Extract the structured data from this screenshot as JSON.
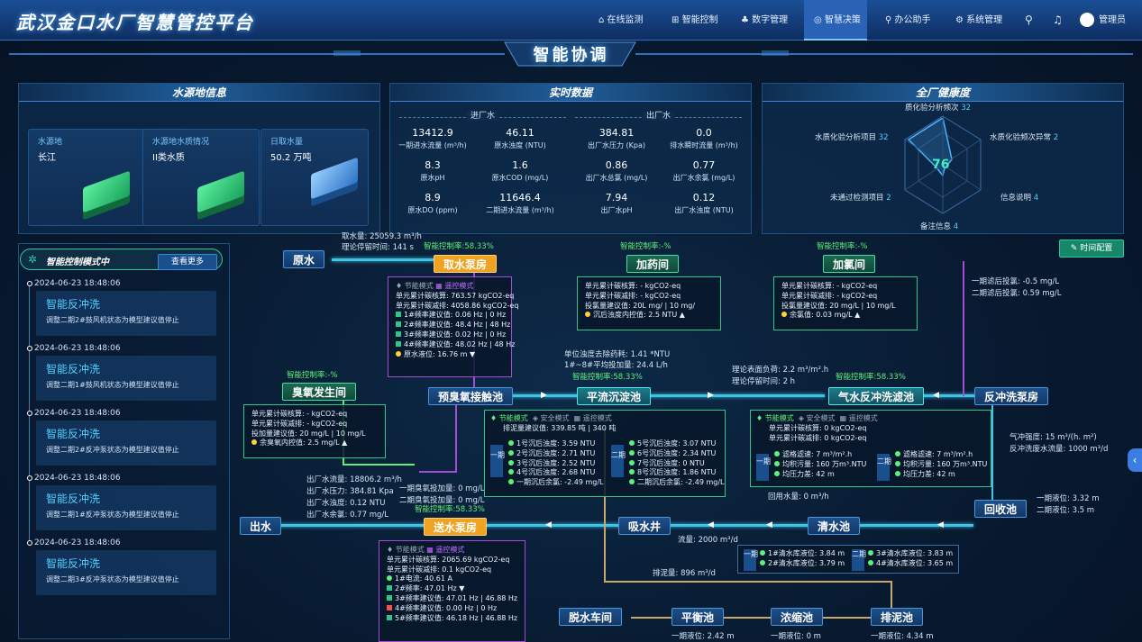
{
  "nav": {
    "brand": "武汉金口水厂智慧管控平台",
    "items": [
      {
        "icon": "⌂",
        "label": "在线监测"
      },
      {
        "icon": "⊞",
        "label": "智能控制"
      },
      {
        "icon": "♣",
        "label": "数字管理"
      },
      {
        "icon": "◎",
        "label": "智慧决策"
      },
      {
        "icon": "⚲",
        "label": "办公助手"
      },
      {
        "icon": "⚙",
        "label": "系统管理"
      }
    ],
    "user": "管理员"
  },
  "page_title": "智能协调",
  "source": {
    "title": "水源地信息",
    "cards": [
      {
        "label": "水源地",
        "value": "长江"
      },
      {
        "label": "水源地水质情况",
        "value": "II类水质"
      },
      {
        "label": "日取水量",
        "value": "50.2 万吨"
      }
    ]
  },
  "realtime": {
    "title": "实时数据",
    "in_title": "进厂水",
    "out_title": "出厂水",
    "cells": [
      {
        "v": "13412.9",
        "l": "一期进水流量 (m³/h)"
      },
      {
        "v": "46.11",
        "l": "原水浊度 (NTU)"
      },
      {
        "v": "384.81",
        "l": "出厂水压力 (Kpa)"
      },
      {
        "v": "0.0",
        "l": "排水瞬时流量 (m³/h)"
      },
      {
        "v": "8.3",
        "l": "原水pH"
      },
      {
        "v": "1.6",
        "l": "原水COD (mg/L)"
      },
      {
        "v": "0.86",
        "l": "出厂水总氯 (mg/L)"
      },
      {
        "v": "0.77",
        "l": "出厂水余氯 (mg/L)"
      },
      {
        "v": "8.9",
        "l": "原水DO (ppm)"
      },
      {
        "v": "11646.4",
        "l": "二期进水流量 (m³/h)"
      },
      {
        "v": "7.94",
        "l": "出厂水pH"
      },
      {
        "v": "0.12",
        "l": "出厂水浊度 (NTU)"
      }
    ]
  },
  "health": {
    "title": "全厂健康度",
    "score": "76",
    "axes": [
      {
        "label": "质化验分析频次",
        "value": "32"
      },
      {
        "label": "水质化验频次异常",
        "value": "2"
      },
      {
        "label": "信息说明",
        "value": "4"
      },
      {
        "label": "备注信息",
        "value": "4"
      },
      {
        "label": "未通过检测项目",
        "value": "2"
      },
      {
        "label": "水质化验分析项目",
        "value": "32"
      }
    ]
  },
  "sidebar": {
    "mode": "智能控制模式中",
    "more": "查看更多",
    "events": [
      {
        "time": "2024-06-23 18:48:06",
        "title": "智能反冲洗",
        "desc": "调整二期2#鼓风机状态为模型建议值停止"
      },
      {
        "time": "2024-06-23 18:48:06",
        "title": "智能反冲洗",
        "desc": "调整二期1#鼓风机状态为模型建议值停止"
      },
      {
        "time": "2024-06-23 18:48:06",
        "title": "智能反冲洗",
        "desc": "调整二期2#反冲泵状态为模型建议值停止"
      },
      {
        "time": "2024-06-23 18:48:06",
        "title": "智能反冲洗",
        "desc": "调整二期1#反冲泵状态为模型建议值停止"
      },
      {
        "time": "2024-06-23 18:48:06",
        "title": "智能反冲洗",
        "desc": "调整二期3#反冲泵状态为模型建议值停止"
      }
    ]
  },
  "timecfg": "时间配置",
  "nodes": {
    "raw": "原水",
    "intake": "取水泵房",
    "dosing": "加药间",
    "chlor": "加氯间",
    "ozone": "臭氧发生间",
    "preox": "预臭氧接触池",
    "sed": "平流沉淀池",
    "filter": "气水反冲洗滤池",
    "backpump": "反冲洗泵房",
    "recover": "回收池",
    "clear": "清水池",
    "suck": "吸水井",
    "send": "送水泵房",
    "out": "出水",
    "dewater": "脱水车间",
    "balance": "平衡池",
    "thicken": "浓缩池",
    "sludge": "排泥池"
  },
  "labels": {
    "intake_flow": "取水量: 25059.3 m³/h",
    "retention1": "理论停留时间: 141 s",
    "intake_rate": "智能控制率:58.33%",
    "dosing_rate": "智能控制率:-%",
    "chlor_rate": "智能控制率:-%",
    "ozone_rate": "智能控制率:-%",
    "sed_consume": "单位浊度去除药耗: 1.41 *NTU",
    "sed_avg": "1#~8#平均投加量: 24.4 L/h",
    "sed_rate": "智能控制率:58.33%",
    "surface_load": "理论表面负荷: 2.2 m³/m².h",
    "retention2": "理论停留时间: 2 h",
    "filter_rate": "智能控制率:58.33%",
    "post_chlor1": "一期滤后投氯: -0.5 mg/L",
    "post_chlor2": "二期滤后投氯: 0.59 mg/L",
    "air_intensity": "气冲强度: 15 m³/(h. m²)",
    "backwash_flow": "反冲洗废水流量: 1000 m³/d",
    "recycle": "回用水量: 0 m³/h",
    "level1": "一期液位: 3.32 m",
    "level2": "二期液位: 3.5 m",
    "out_flow": "出厂水流量: 18806.2 m³/h",
    "out_press": "出厂水压力: 384.81 Kpa",
    "out_turb": "出厂水浊度: 0.12 NTU",
    "out_cl": "出厂水余氯: 0.77 mg/L",
    "ozone1": "一期臭氧投加量: 0 mg/L",
    "ozone2": "二期臭氧投加量: 0 mg/L",
    "send_rate": "智能控制率:58.33%",
    "flow2000": "流量: 2000 m³/d",
    "sludge_flow": "排泥量: 896 m³/d",
    "lv_dewater": "一期液位: 2.42 m",
    "lv_thicken": "一期液位: 0 m",
    "lv_sludge": "一期液位: 4.34 m"
  },
  "intake_box": {
    "mode1": "节能模式",
    "mode2": "遥控模式",
    "lines": [
      "单元累计碳核算: 763.57 kgCO2-eq",
      "单元累计碳减排: 4058.86 kgCO2-eq",
      "1#频率建议值: 0.06 Hz | 0 Hz",
      "2#频率建议值: 48.4 Hz | 48 Hz",
      "3#频率建议值: 0.02 Hz | 0 Hz",
      "4#频率建议值: 48.02 Hz | 48 Hz",
      "原水液位: 16.76 m ▼"
    ]
  },
  "dosing_box": {
    "lines": [
      "单元累计碳核算: - kgCO2-eq",
      "单元累计碳减排: - kgCO2-eq",
      "投氯量建议值: 20L mg/ | 10 mg/",
      "沉后浊度内控值: 2.5 NTU ▲"
    ]
  },
  "chlor_box": {
    "lines": [
      "单元累计碳核算: - kgCO2-eq",
      "单元累计碳减排: - kgCO2-eq",
      "投氯量建议值: 20 mg/L | 10 mg/L",
      "余氯值: 0.03 mg/L ▲"
    ]
  },
  "ozone_box": {
    "lines": [
      "单元累计碳核算: - kgCO2-eq",
      "单元累计碳减排: - kgCO2-eq",
      "投加量建议值: 20 mg/L | 10 mg/L",
      "余臭氧内控值: 2.5 mg/L ▲"
    ]
  },
  "sed_box": {
    "m1": "节能模式",
    "m2": "安全模式",
    "m3": "遥控模式",
    "head": "排泥量建议值: 339.85 吨 | 340 吨",
    "p1": "一期",
    "p2": "二期",
    "left": [
      "1号沉后浊度: 3.59 NTU",
      "2号沉后浊度: 2.71 NTU",
      "3号沉后浊度: 2.52 NTU",
      "4号沉后浊度: 2.68 NTU",
      "一期沉后余氯: -2.49 mg/L"
    ],
    "right": [
      "5号沉后浊度: 3.07 NTU",
      "6号沉后浊度: 2.34 NTU",
      "7号沉后浊度: 0 NTU",
      "8号沉后浊度: 1.86 NTU",
      "二期沉后余氯: -2.49 mg/L"
    ]
  },
  "filter_box": {
    "m1": "节能模式",
    "m2": "安全模式",
    "m3": "遥控模式",
    "l1": "单元累计碳核算: 0 kgCO2-eq",
    "l2": "单元累计碳减排: 0 kgCO2-eq",
    "p1": "一期",
    "p2": "二期",
    "left": [
      "滤格滤速: 7 m³/m².h",
      "均积污量: 160 万m³.NTU",
      "均压力差: 42 m"
    ],
    "right": [
      "滤格滤速: 7 m³/m².h",
      "均积污量: 160 万m³.NTU",
      "均压力差: 42 m"
    ]
  },
  "clear_box": {
    "p1": "一期",
    "p2": "二期",
    "l": [
      "1#清水库液位: 3.84 m",
      "2#清水库液位: 3.79 m"
    ],
    "r": [
      "3#清水库液位: 3.83 m",
      "4#清水库液位: 3.65 m"
    ]
  },
  "send_box": {
    "mode1": "节能模式",
    "mode2": "遥控模式",
    "lines": [
      "单元累计碳核算: 2065.69 kgCO2-eq",
      "单元累计碳减排: 0.1 kgCO2-eq",
      "1#电流: 40.61 A",
      "2#频率: 47.01 Hz ▼",
      "3#频率建议值: 47.01 Hz | 46.88 Hz",
      "4#频率建议值: 0.00 Hz | 0 Hz",
      "5#频率建议值: 46.18 Hz | 46.88 Hz"
    ]
  }
}
